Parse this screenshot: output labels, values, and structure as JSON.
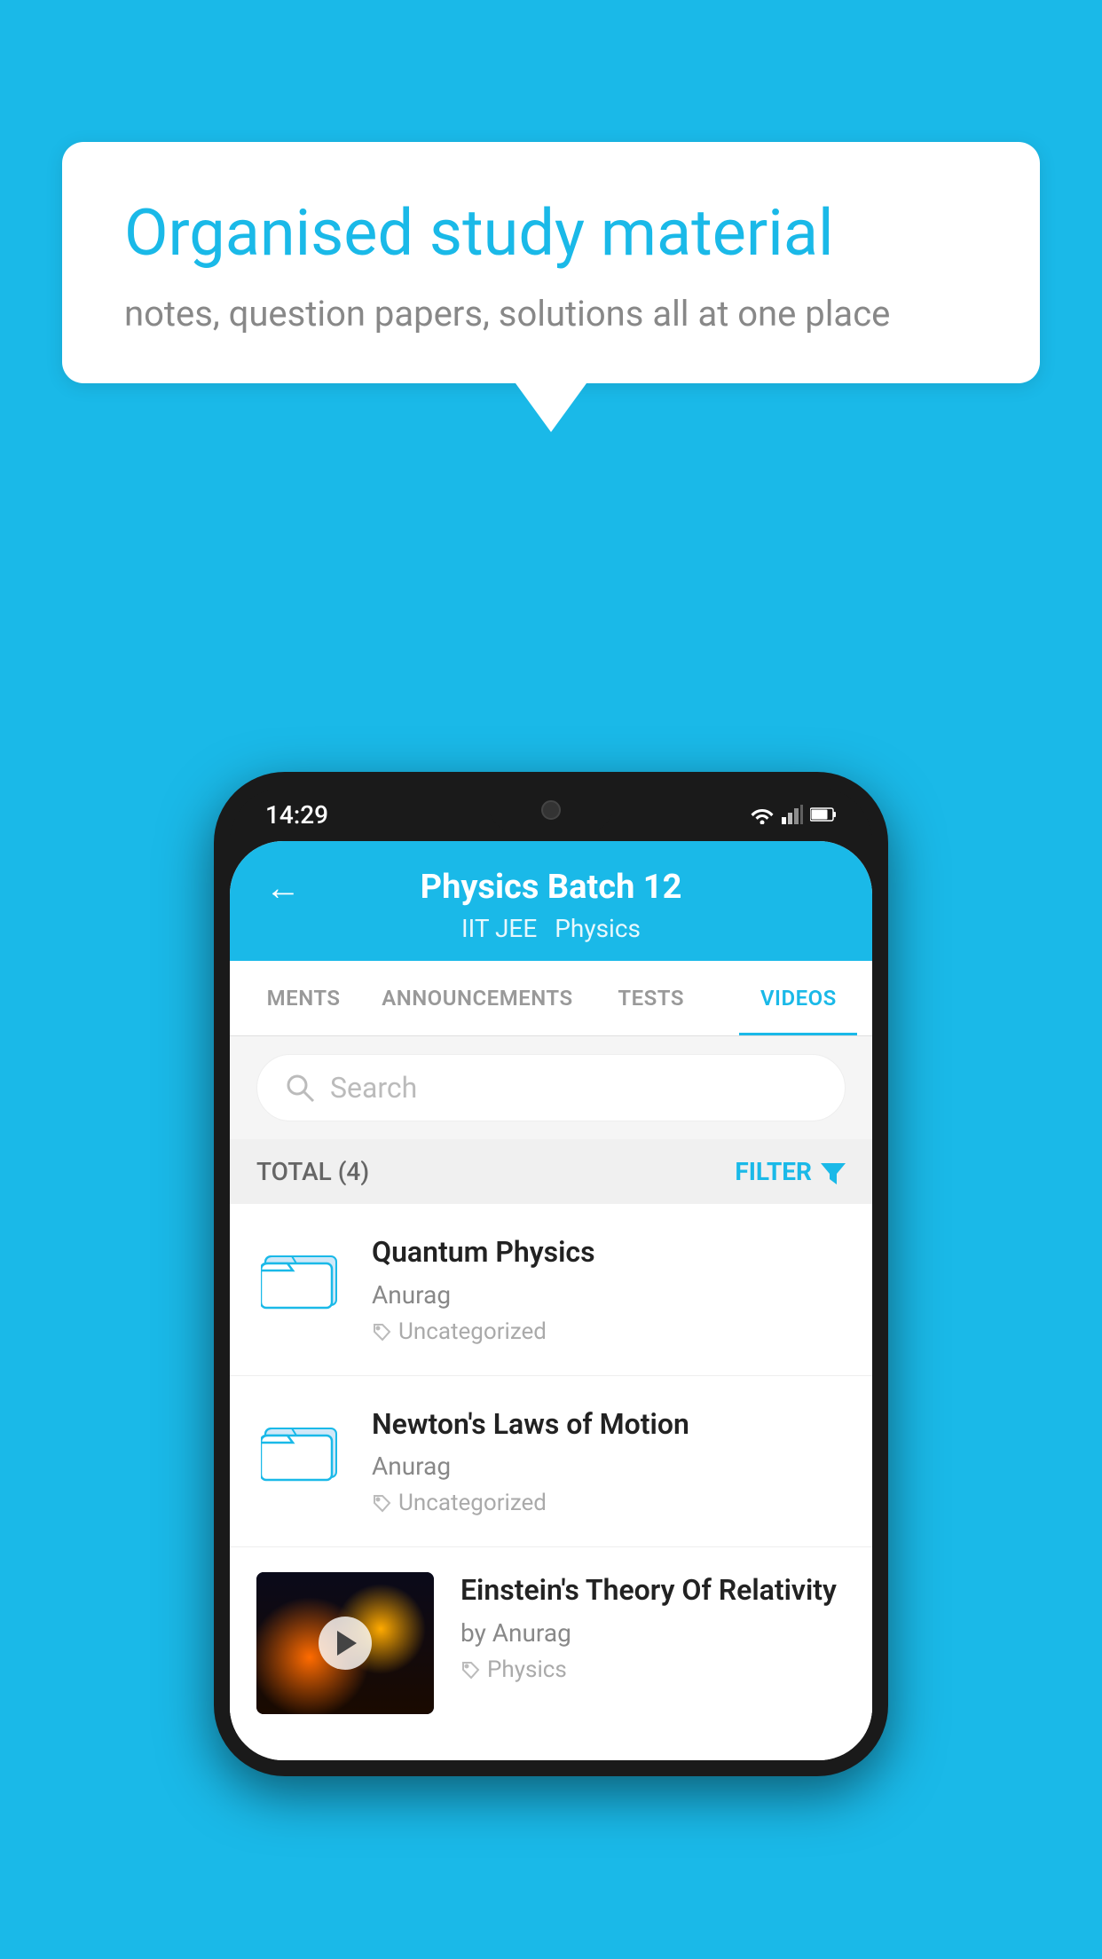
{
  "background_color": "#1ab9e8",
  "speech_bubble": {
    "title": "Organised study material",
    "subtitle": "notes, question papers, solutions all at one place"
  },
  "phone": {
    "time": "14:29",
    "header": {
      "back_label": "←",
      "title": "Physics Batch 12",
      "subtitle_tag1": "IIT JEE",
      "subtitle_tag2": "Physics"
    },
    "tabs": [
      {
        "label": "MENTS",
        "active": false
      },
      {
        "label": "ANNOUNCEMENTS",
        "active": false
      },
      {
        "label": "TESTS",
        "active": false
      },
      {
        "label": "VIDEOS",
        "active": true
      }
    ],
    "search": {
      "placeholder": "Search"
    },
    "filter_bar": {
      "total_label": "TOTAL (4)",
      "filter_label": "FILTER"
    },
    "video_items": [
      {
        "id": 1,
        "title": "Quantum Physics",
        "author": "Anurag",
        "tag": "Uncategorized",
        "type": "folder",
        "has_thumb": false
      },
      {
        "id": 2,
        "title": "Newton's Laws of Motion",
        "author": "Anurag",
        "tag": "Uncategorized",
        "type": "folder",
        "has_thumb": false
      },
      {
        "id": 3,
        "title": "Einstein's Theory Of Relativity",
        "author": "by Anurag",
        "tag": "Physics",
        "type": "video",
        "has_thumb": true
      }
    ]
  }
}
